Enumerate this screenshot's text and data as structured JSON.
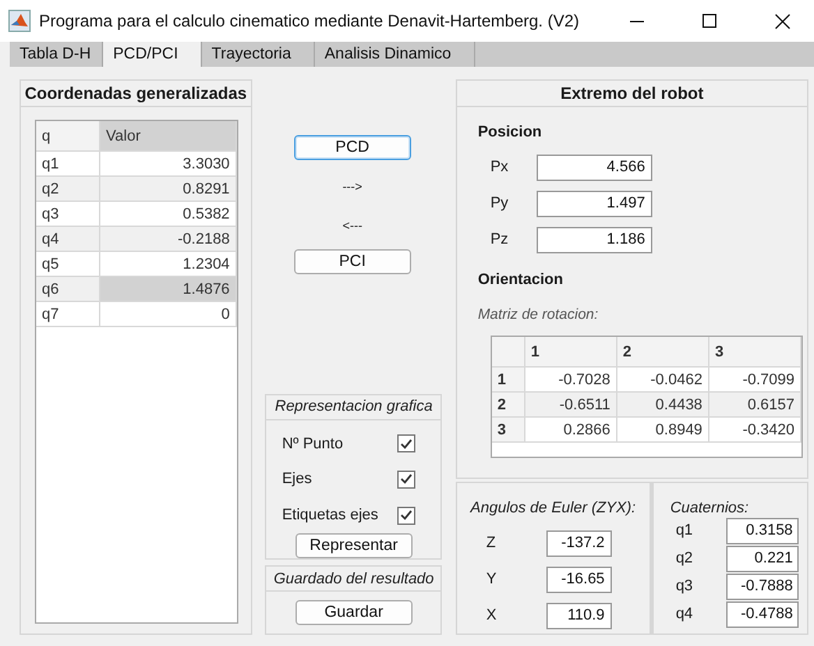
{
  "window": {
    "title": "Programa para el calculo cinematico mediante Denavit-Hartemberg. (V2)"
  },
  "tabs": [
    {
      "label": "Tabla D-H",
      "selected": false
    },
    {
      "label": "PCD/PCI",
      "selected": true
    },
    {
      "label": "Trayectoria",
      "selected": false
    },
    {
      "label": "Analisis Dinamico",
      "selected": false
    }
  ],
  "coordinates_panel": {
    "title": "Coordenadas generalizadas",
    "columns": [
      {
        "label": "q",
        "selected": false
      },
      {
        "label": "Valor",
        "selected": true
      }
    ],
    "rows": [
      {
        "q": "q1",
        "value": "3.3030",
        "selected": false
      },
      {
        "q": "q2",
        "value": "0.8291",
        "selected": false
      },
      {
        "q": "q3",
        "value": "0.5382",
        "selected": false
      },
      {
        "q": "q4",
        "value": "-0.2188",
        "selected": false
      },
      {
        "q": "q5",
        "value": "1.2304",
        "selected": false
      },
      {
        "q": "q6",
        "value": "1.4876",
        "selected": true
      },
      {
        "q": "q7",
        "value": "0",
        "selected": false
      }
    ]
  },
  "kinematics": {
    "buttons": [
      {
        "label": "PCD",
        "focused": true
      },
      {
        "label": "PCI",
        "focused": false
      }
    ],
    "forward_arrow": "--->",
    "backward_arrow": "<---"
  },
  "graphics_panel": {
    "title": "Representacion grafica",
    "options": [
      {
        "label": "Nº Punto",
        "checked": true
      },
      {
        "label": "Ejes",
        "checked": true
      },
      {
        "label": "Etiquetas ejes",
        "checked": true
      }
    ],
    "button": "Representar"
  },
  "save_panel": {
    "title": "Guardado del resultado",
    "button": "Guardar"
  },
  "end_effector_panel": {
    "title": "Extremo del robot",
    "position": {
      "title": "Posicion",
      "fields": [
        {
          "label": "Px",
          "value": "4.566"
        },
        {
          "label": "Py",
          "value": "1.497"
        },
        {
          "label": "Pz",
          "value": "1.186"
        }
      ]
    },
    "orientation": {
      "title": "Orientacion",
      "matrix_label": "Matriz de rotacion:",
      "columns": [
        "1",
        "2",
        "3"
      ],
      "rows": [
        {
          "label": "1",
          "values": [
            "-0.7028",
            "-0.0462",
            "-0.7099"
          ]
        },
        {
          "label": "2",
          "values": [
            "-0.6511",
            "0.4438",
            "0.6157"
          ]
        },
        {
          "label": "3",
          "values": [
            "0.2866",
            "0.8949",
            "-0.3420"
          ]
        }
      ]
    }
  },
  "euler_panel": {
    "title": "Angulos de Euler (ZYX):",
    "fields": [
      {
        "label": "Z",
        "value": "-137.2"
      },
      {
        "label": "Y",
        "value": "-16.65"
      },
      {
        "label": "X",
        "value": "110.9"
      }
    ]
  },
  "quaternion_panel": {
    "title": "Cuaternios:",
    "fields": [
      {
        "label": "q1",
        "value": "0.3158"
      },
      {
        "label": "q2",
        "value": "0.221"
      },
      {
        "label": "q3",
        "value": "-0.7888"
      },
      {
        "label": "q4",
        "value": "-0.4788"
      }
    ]
  }
}
